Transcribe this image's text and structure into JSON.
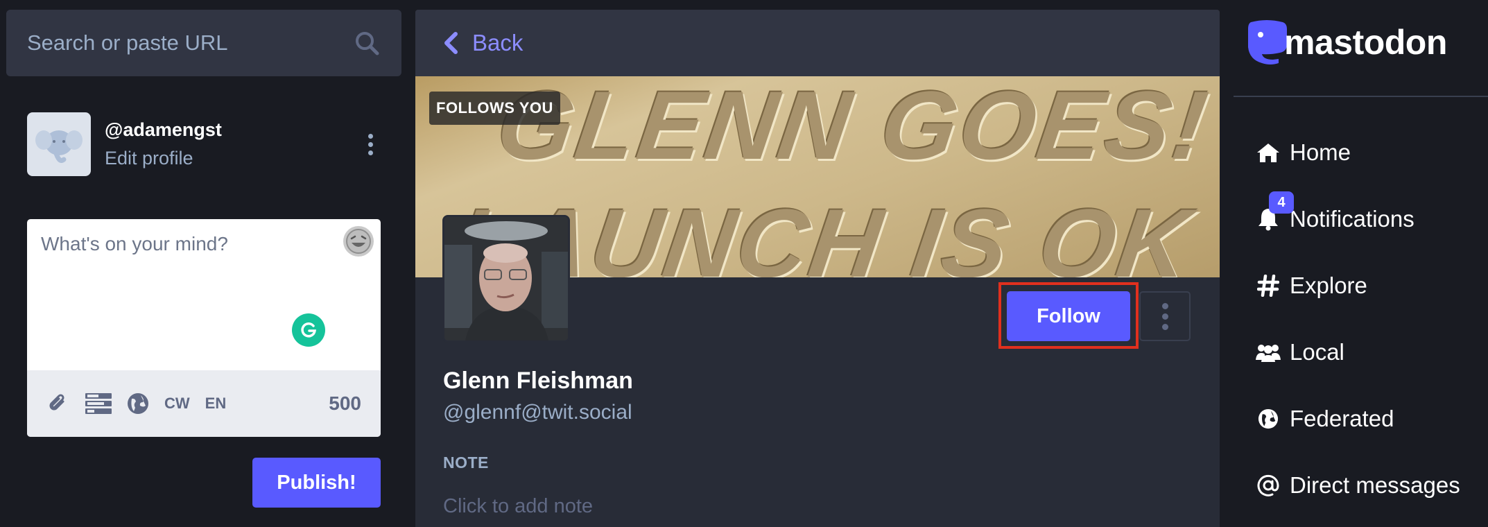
{
  "search": {
    "placeholder": "Search or paste URL"
  },
  "account": {
    "handle": "@adamengst",
    "edit_label": "Edit profile"
  },
  "composer": {
    "placeholder": "What's on your mind?",
    "toolbar": {
      "cw_label": "CW",
      "lang_label": "EN",
      "char_count": "500"
    },
    "publish_label": "Publish!"
  },
  "column": {
    "back_label": "Back"
  },
  "profile": {
    "header_text_line1": "GLENN GOES!",
    "header_text_line2": "LAUNCH IS OK",
    "follows_you_label": "FOLLOWS YOU",
    "display_name": "Glenn Fleishman",
    "acct": "@glennf@twit.social",
    "follow_label": "Follow",
    "note_label": "NOTE",
    "note_placeholder": "Click to add note"
  },
  "brand": {
    "logo_text": "mastodon",
    "accent": "#595aff",
    "highlight_outline": "#e0301e"
  },
  "nav": {
    "items": [
      {
        "label": "Home",
        "icon": "home-icon"
      },
      {
        "label": "Notifications",
        "icon": "bell-icon",
        "badge": "4"
      },
      {
        "label": "Explore",
        "icon": "hashtag-icon"
      },
      {
        "label": "Local",
        "icon": "users-icon"
      },
      {
        "label": "Federated",
        "icon": "globe-icon"
      },
      {
        "label": "Direct messages",
        "icon": "at-icon"
      }
    ]
  }
}
